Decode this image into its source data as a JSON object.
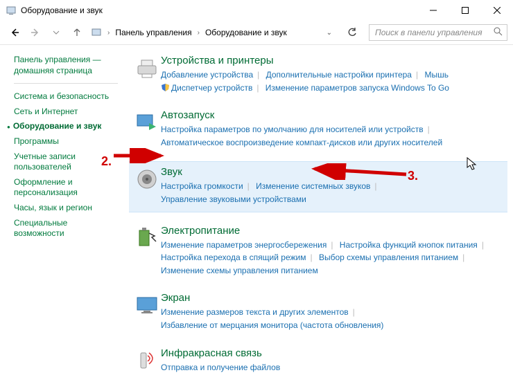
{
  "window": {
    "title": "Оборудование и звук"
  },
  "breadcrumb": {
    "root": "Панель управления",
    "current": "Оборудование и звук"
  },
  "search": {
    "placeholder": "Поиск в панели управления"
  },
  "sidebar": {
    "home": "Панель управления — домашняя страница",
    "items": [
      {
        "label": "Система и безопасность",
        "active": false
      },
      {
        "label": "Сеть и Интернет",
        "active": false
      },
      {
        "label": "Оборудование и звук",
        "active": true
      },
      {
        "label": "Программы",
        "active": false
      },
      {
        "label": "Учетные записи пользователей",
        "active": false
      },
      {
        "label": "Оформление и персонализация",
        "active": false
      },
      {
        "label": "Часы, язык и регион",
        "active": false
      },
      {
        "label": "Специальные возможности",
        "active": false
      }
    ]
  },
  "categories": {
    "devices": {
      "title": "Устройства и принтеры",
      "links": [
        "Добавление устройства",
        "Дополнительные настройки принтера",
        "Мышь",
        "Диспетчер устройств",
        "Изменение параметров запуска Windows To Go"
      ],
      "shield_index": 3
    },
    "autoplay": {
      "title": "Автозапуск",
      "links": [
        "Настройка параметров по умолчанию для носителей или устройств",
        "Автоматическое воспроизведение компакт-дисков или других носителей"
      ]
    },
    "sound": {
      "title": "Звук",
      "links": [
        "Настройка громкости",
        "Изменение системных звуков",
        "Управление звуковыми устройствами"
      ]
    },
    "power": {
      "title": "Электропитание",
      "links": [
        "Изменение параметров энергосбережения",
        "Настройка функций кнопок питания",
        "Настройка перехода в спящий режим",
        "Выбор схемы управления питанием",
        "Изменение схемы управления питанием"
      ]
    },
    "display": {
      "title": "Экран",
      "links": [
        "Изменение размеров текста и других элементов",
        "Избавление от мерцания монитора (частота обновления)"
      ]
    },
    "infrared": {
      "title": "Инфракрасная связь",
      "links": [
        "Отправка и получение файлов"
      ]
    }
  },
  "annotations": {
    "step2": "2.",
    "step3": "3."
  }
}
